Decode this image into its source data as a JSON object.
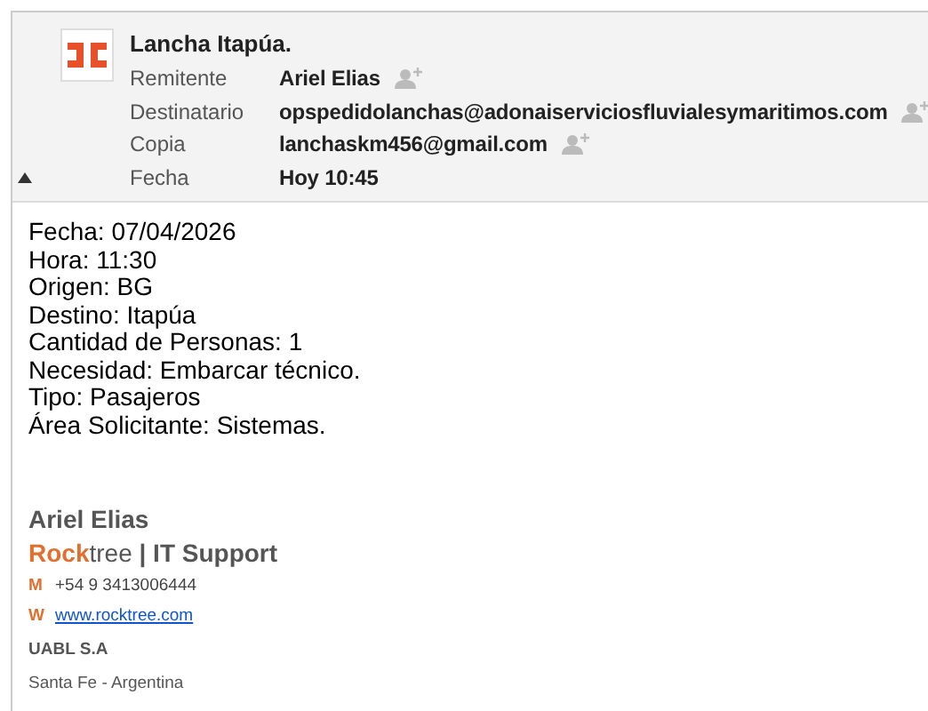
{
  "header": {
    "subject": "Lancha Itapúa.",
    "expanded": true,
    "fields": [
      {
        "label": "Remitente",
        "value": "Ariel Elias",
        "add_contact": true
      },
      {
        "label": "Destinatario",
        "value": "opspedidolanchas@adonaiserviciosfluvialesymaritimos.com",
        "add_contact": true
      },
      {
        "label": "Copia",
        "value": "lanchaskm456@gmail.com",
        "add_contact": true
      },
      {
        "label": "Fecha",
        "value": "Hoy 10:45",
        "add_contact": false
      }
    ]
  },
  "body": {
    "lines": [
      "Fecha: 07/04/2026",
      "Hora: 11:30",
      "Origen: BG",
      "Destino: Itapúa",
      "Cantidad de Personas: 1",
      "Necesidad: Embarcar técnico.",
      "Tipo: Pasajeros",
      "Área Solicitante: Sistemas."
    ]
  },
  "signature": {
    "name": "Ariel Elias",
    "company": "**Rock**tree **| IT Support**",
    "contacts": [
      {
        "letter": "M",
        "value": "+54 9 3413006444",
        "kind": "phone"
      },
      {
        "letter": "W",
        "value": "www.rocktree.com",
        "kind": "link"
      }
    ],
    "organization": "UABL S.A",
    "location": "Santa Fe - Argentina"
  }
}
